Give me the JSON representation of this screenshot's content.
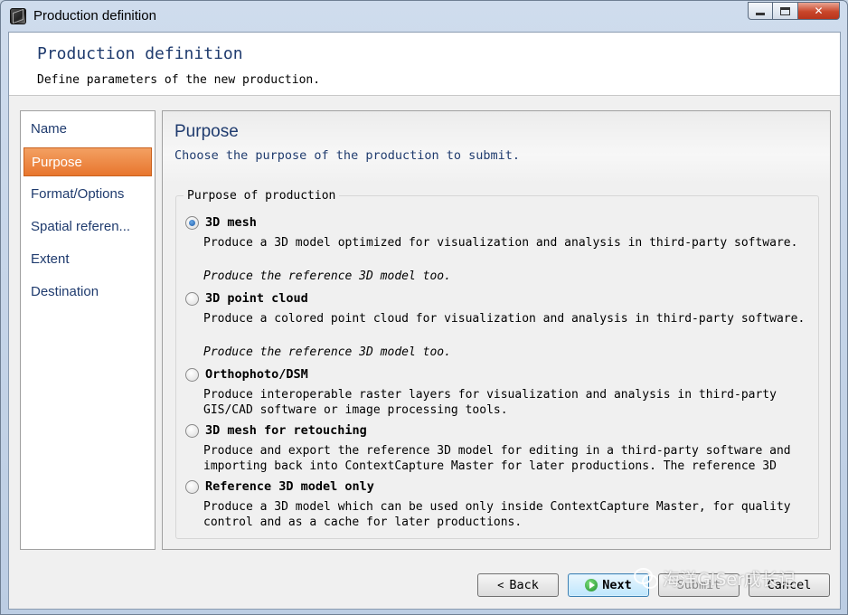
{
  "window": {
    "title": "Production definition",
    "icon": "app-cube-icon"
  },
  "header": {
    "title": "Production definition",
    "subtitle": "Define parameters of the new production."
  },
  "nav": {
    "items": [
      {
        "label": "Name",
        "selected": false
      },
      {
        "label": "Purpose",
        "selected": true
      },
      {
        "label": "Format/Options",
        "selected": false
      },
      {
        "label": "Spatial referen...",
        "selected": false
      },
      {
        "label": "Extent",
        "selected": false
      },
      {
        "label": "Destination",
        "selected": false
      }
    ]
  },
  "content": {
    "title": "Purpose",
    "subtitle": "Choose the purpose of the production to submit.",
    "group_label": "Purpose of production",
    "options": [
      {
        "label": "3D mesh",
        "checked": true,
        "description": "Produce a 3D model optimized for visualization and analysis in third-party software.",
        "note": "Produce the reference 3D model too."
      },
      {
        "label": "3D point cloud",
        "checked": false,
        "description": "Produce a colored point cloud for visualization and analysis in third-party software.",
        "note": "Produce the reference 3D model too."
      },
      {
        "label": "Orthophoto/DSM",
        "checked": false,
        "description": "Produce interoperable raster layers for visualization and analysis in third-party GIS/CAD software or image processing tools.",
        "note": ""
      },
      {
        "label": "3D mesh for retouching",
        "checked": false,
        "description": "Produce and export the reference 3D model for editing in a third-party software and importing back into ContextCapture Master for later productions. The reference 3D",
        "note": ""
      },
      {
        "label": "Reference 3D model only",
        "checked": false,
        "description": "Produce a 3D model which can be used only inside ContextCapture Master, for quality control and as a cache for later productions.",
        "note": ""
      }
    ]
  },
  "buttons": {
    "back": "Back",
    "next": "Next",
    "submit": "Submit",
    "cancel": "Cancel"
  },
  "watermark": {
    "text": "海洋GISer成长记"
  },
  "colors": {
    "selected_nav": "#e8762e",
    "heading_blue": "#1f3b6e"
  }
}
